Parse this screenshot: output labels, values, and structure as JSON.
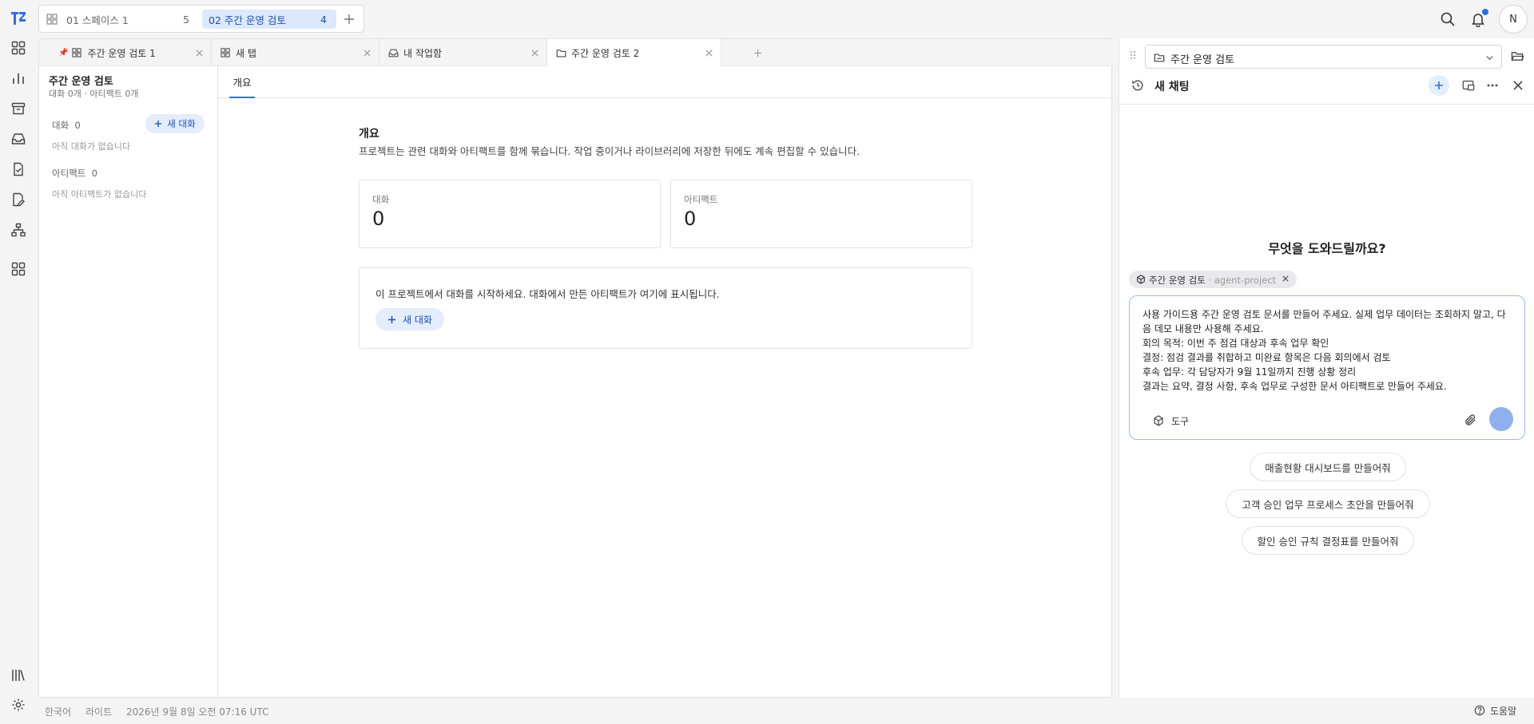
{
  "spaces": [
    {
      "label": "01 스페이스 1",
      "count": "5"
    },
    {
      "label": "02 주간 운영 검토",
      "count": "4"
    }
  ],
  "user": {
    "avatar_initial": "N"
  },
  "doc_tabs": [
    {
      "label": "주간 운영 검토 1"
    },
    {
      "label": "새 탭"
    },
    {
      "label": "내 작업함"
    },
    {
      "label": "주간 운영 검토 2"
    }
  ],
  "project": {
    "title": "주간 운영 검토",
    "subtitle": "대화 0개 · 아티팩트 0개",
    "chats_label": "대화",
    "chats_count": "0",
    "new_chat": "새 대화",
    "no_chats": "아직 대화가 없습니다",
    "artifacts_label": "아티팩트",
    "artifacts_count": "0",
    "no_artifacts": "아직 아티팩트가 없습니다"
  },
  "overview": {
    "tab": "개요",
    "heading": "개요",
    "description": "프로젝트는 관련 대화와 아티팩트를 함께 묶습니다. 작업 중이거나 라이브러리에 저장한 뒤에도 계속 편집할 수 있습니다.",
    "stat_chats_label": "대화",
    "stat_chats_value": "0",
    "stat_artifacts_label": "아티팩트",
    "stat_artifacts_value": "0",
    "cta_text": "이 프로젝트에서 대화를 시작하세요. 대화에서 만든 아티팩트가 여기에 표시됩니다.",
    "cta_button": "새 대화"
  },
  "chat": {
    "project_select": "주간 운영 검토",
    "title": "새 채팅",
    "greeting": "무엇을 도와드릴까요?",
    "chip_label": "주간 운영 검토",
    "chip_sub": "· agent-project",
    "message_lines": [
      "사용 가이드용 주간 운영 검토 문서를 만들어 주세요. 실제 업무 데이터는 조회하지 말고, 다",
      "음 데모 내용만 사용해 주세요.",
      "회의 목적: 이번 주 점검 대상과 후속 업무 확인",
      "결정: 점검 결과를 취합하고 미완료 항목은 다음 회의에서 검토",
      "후속 업무: 각 담당자가 9월 11일까지 진행 상황 정리",
      "결과는 요약, 결정 사항, 후속 업무로 구성한 문서 아티팩트로 만들어 주세요."
    ],
    "tools_label": "도구",
    "suggestions": [
      "매출현황 대시보드를 만들어줘",
      "고객 승인 업무 프로세스 초안을 만들어줘",
      "할인 승인 규칙 결정표를 만들어줘"
    ]
  },
  "status": {
    "language": "한국어",
    "theme": "라이트",
    "datetime": "2026년 9월 8일 오전 07:16 UTC",
    "help": "도움말"
  },
  "colors": {
    "accent": "#2f6fe0",
    "accent_soft": "#e4edfb",
    "send": "#8fb0ef"
  }
}
